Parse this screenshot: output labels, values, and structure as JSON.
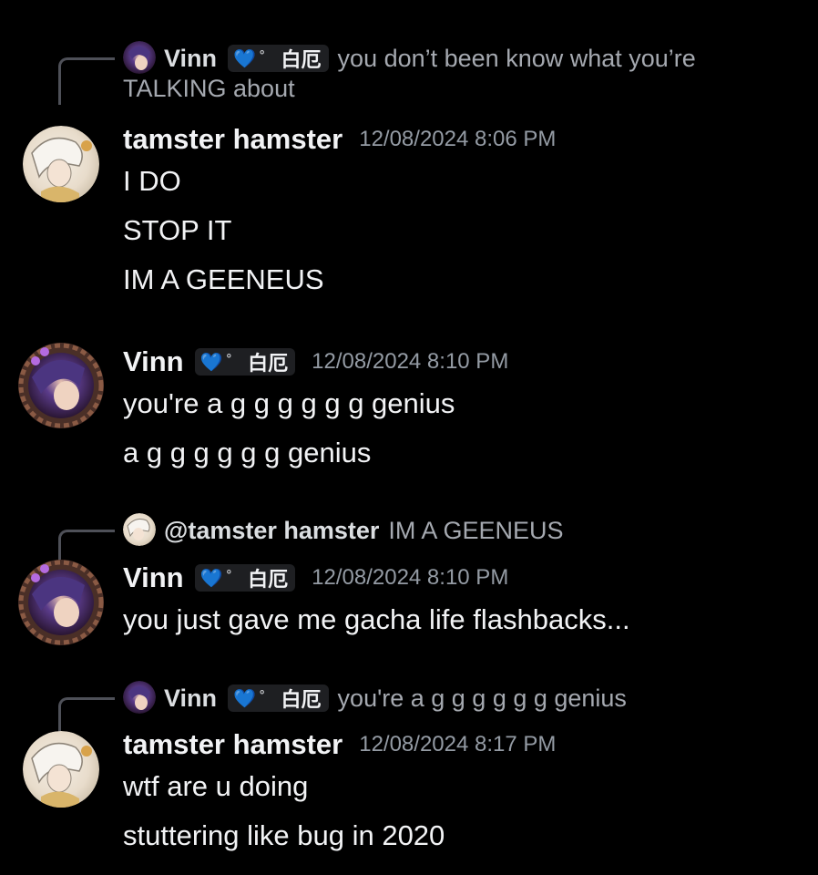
{
  "users": {
    "vinn": "Vinn",
    "tamster": "tamster hamster",
    "tamster_mention": "@tamster hamster",
    "tag_text": "白厄",
    "tag_heart": "💙",
    "tag_degree": "°"
  },
  "colors": {
    "background": "#000000",
    "text": "#f2f3f5",
    "muted": "#949ba4",
    "reply_text": "#a5a9b0",
    "tag_bg": "#1e1f22",
    "reply_spine": "#4e5058"
  },
  "messages": [
    {
      "reply": {
        "author": "Vinn",
        "text": "you don’t been know what you’re",
        "text_cont": "TALKING about"
      },
      "author": "tamster hamster",
      "timestamp": "12/08/2024 8:06 PM",
      "lines": [
        "I DO",
        "STOP IT",
        "IM A GEENEUS"
      ]
    },
    {
      "author": "Vinn",
      "timestamp": "12/08/2024 8:10 PM",
      "lines": [
        "you're a g g g g g g genius",
        "a g g g g g g genius"
      ]
    },
    {
      "reply": {
        "author": "@tamster hamster",
        "text": "IM A GEENEUS"
      },
      "author": "Vinn",
      "timestamp": "12/08/2024 8:10 PM",
      "lines": [
        "you just gave me gacha life flashbacks..."
      ]
    },
    {
      "reply": {
        "author": "Vinn",
        "text": "you're a g g g g g g genius"
      },
      "author": "tamster hamster",
      "timestamp": "12/08/2024 8:17 PM",
      "lines": [
        "wtf are u doing",
        "stuttering like bug in 2020"
      ]
    }
  ]
}
